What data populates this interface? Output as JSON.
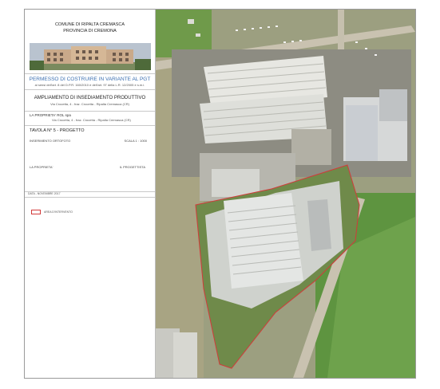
{
  "panel": {
    "comune": "COMUNE DI RIPALTA CREMASCA",
    "provincia": "PROVINCIA DI CREMONA",
    "permesso_title": "PERMESSO DI COSTRUIRE IN VARIANTE AL PGT",
    "permesso_sub": "ai sensi dell'art. 8 del D.P.R. 160/2010 e dell'art. 97 della L.R. 12/2005 e s.m.i.",
    "project_title": "AMPLIAMENTO DI INSEDIAMENTO PRODUTTIVO",
    "project_sub": "Via Crocetta, 4 - fraz. Crocetta - Ripalta Cremasca (CR)",
    "proprieta_label": "LA PROPRIETA' ROL spa",
    "proprieta_address": "Via Crocetta, 4 - fraz. Crocetta - Ripalta Cremasca (CR)",
    "tavola": "TAVOLA N° 5 - PROGETTO",
    "inserimento": "INSERIMENTO ORTOFOTO",
    "scala": "SCALA 1 : 1000",
    "proprieta_sign": "LA PROPRIETA'",
    "progettista_sign": "IL PROGETTISTA",
    "date": "DATA - NOVEMBRE 2017",
    "legend_label": "AREA D'INTERVENTO"
  },
  "colors": {
    "intervention_outline": "#d23a3a",
    "title_blue": "#3b6fb0"
  }
}
